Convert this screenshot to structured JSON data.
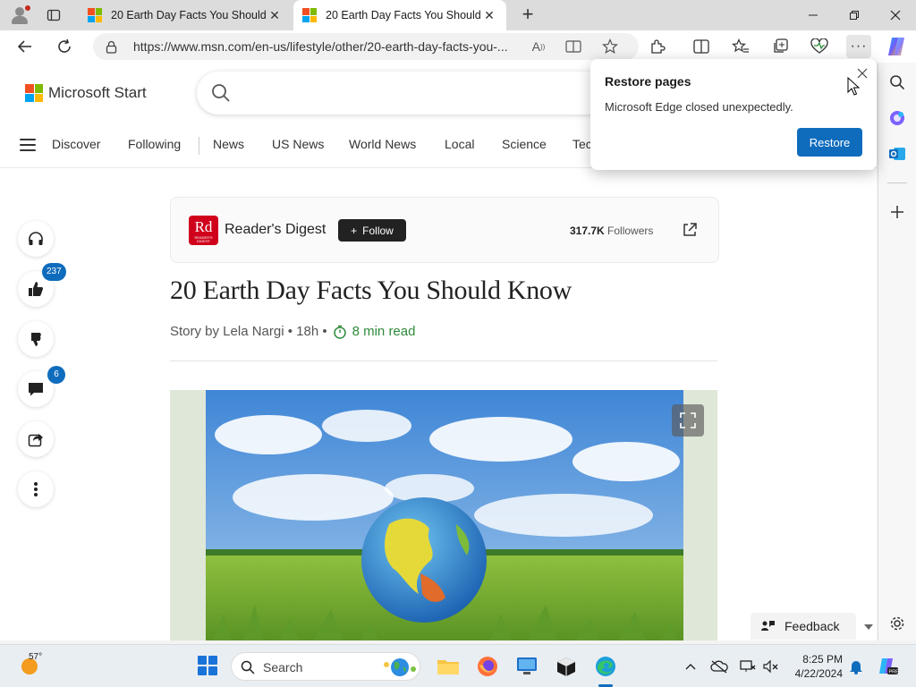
{
  "browser": {
    "tabs": [
      {
        "title": "20 Earth Day Facts You Should Know"
      },
      {
        "title": "20 Earth Day Facts You Should Know"
      }
    ],
    "url": "https://www.msn.com/en-us/lifestyle/other/20-earth-day-facts-you-..."
  },
  "site": {
    "brand": "Microsoft Start",
    "nav": [
      "Discover",
      "Following",
      "News",
      "US News",
      "World News",
      "Local",
      "Science",
      "Tec"
    ]
  },
  "reactions": {
    "likes_count": "237",
    "comments_count": "6"
  },
  "publisher": {
    "logo_text": "Rd",
    "logo_subtext": "READER'S DIGEST",
    "name": "Reader's Digest",
    "follow_label": "Follow",
    "followers_count": "317.7K",
    "followers_label": "Followers"
  },
  "article": {
    "title": "20 Earth Day Facts You Should Know",
    "byline": "Story by Lela Nargi • 18h •",
    "read_time": "8 min read"
  },
  "popup": {
    "title": "Restore pages",
    "message": "Microsoft Edge closed unexpectedly.",
    "button": "Restore"
  },
  "feedback_label": "Feedback",
  "taskbar": {
    "temperature": "57°",
    "search_label": "Search",
    "time": "8:25 PM",
    "date": "4/22/2024"
  },
  "colors": {
    "accent": "#0f6cbd",
    "read_time": "#2e8b3a",
    "rd_red": "#d0021b"
  }
}
